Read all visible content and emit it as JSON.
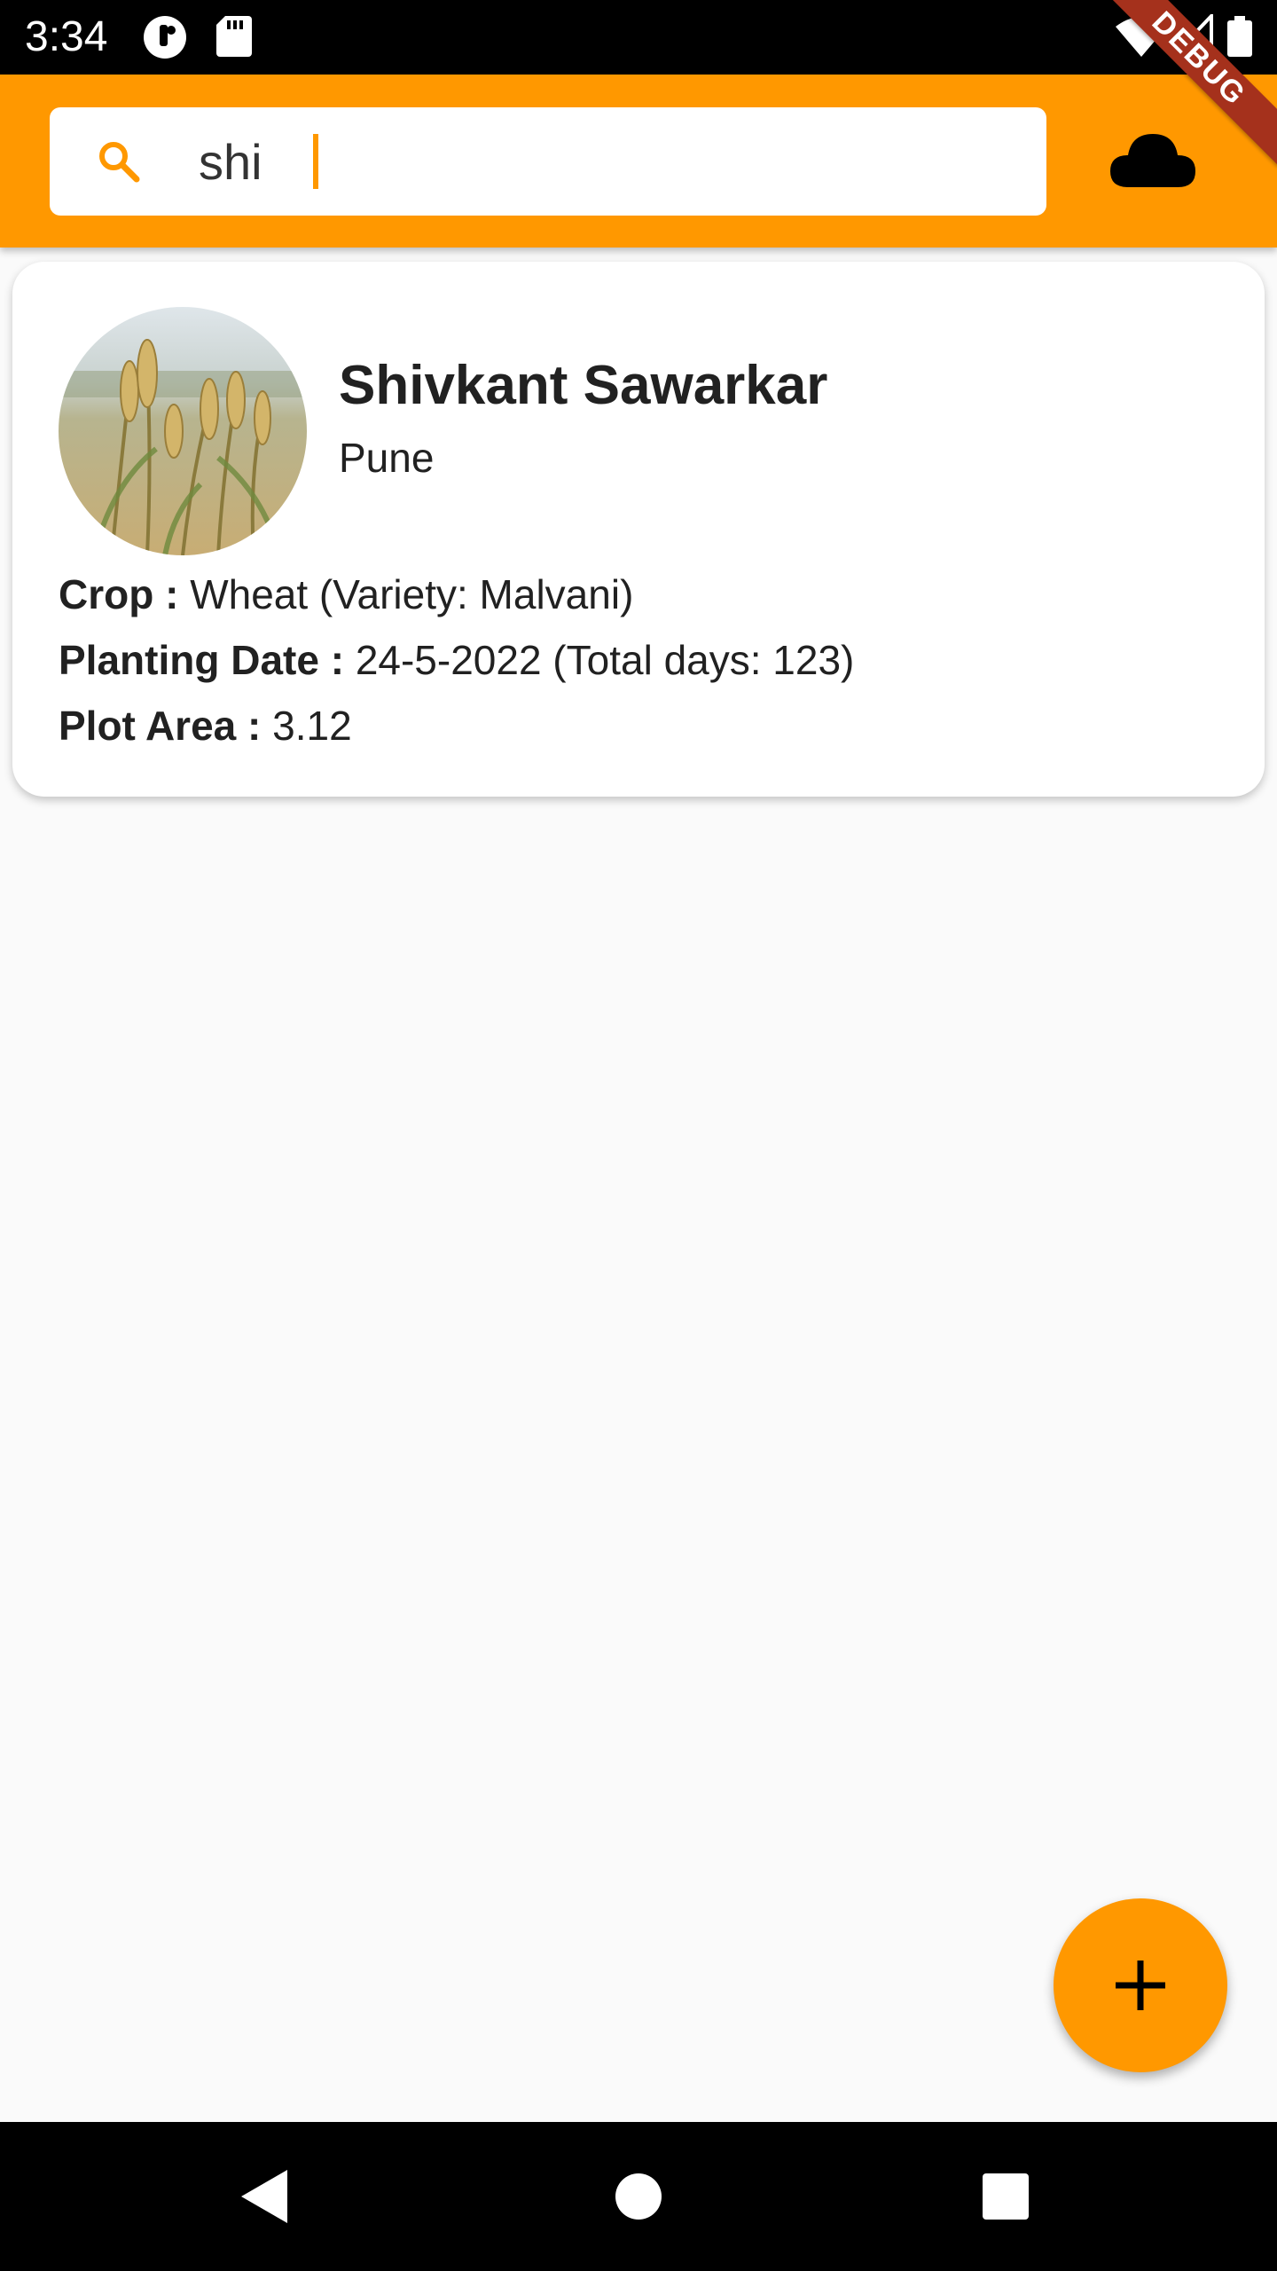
{
  "status_bar": {
    "time": "3:34"
  },
  "search": {
    "value": "shi",
    "icon": "search-icon"
  },
  "app_bar": {
    "color": "#ff9800",
    "cloud_icon": "cloud-icon",
    "debug_label": "DEBUG"
  },
  "farmers": [
    {
      "name": "Shivkant Sawarkar",
      "city": "Pune",
      "crop_label": "Crop :",
      "crop_value": "Wheat (Variety: Malvani)",
      "planting_label": "Planting Date :",
      "planting_value": "24-5-2022 (Total days: 123)",
      "plot_label": "Plot Area :",
      "plot_value": "3.12"
    }
  ],
  "fab": {
    "icon": "plus-icon"
  },
  "nav": {
    "back_icon": "back-icon",
    "home_icon": "home-icon",
    "recents_icon": "recents-icon"
  }
}
